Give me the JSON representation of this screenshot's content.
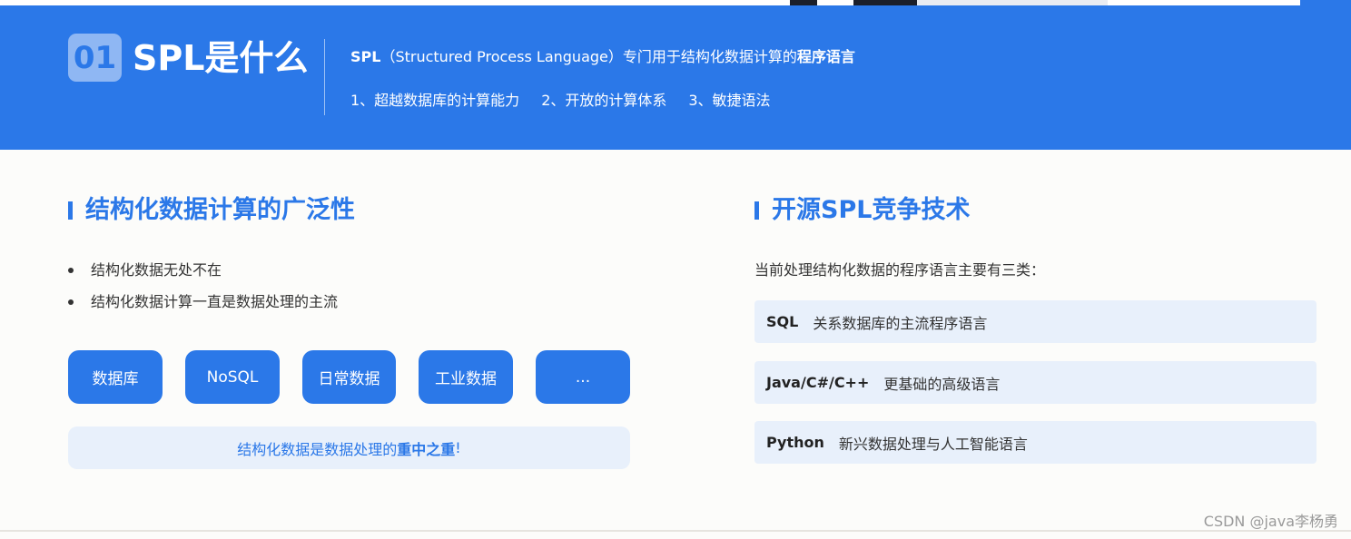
{
  "banner": {
    "number": "01",
    "title": "SPL是什么",
    "desc_bold_prefix": "SPL",
    "desc_middle": "（Structured Process Language）专门用于结构化数据计算的",
    "desc_bold_suffix": "程序语言",
    "features": [
      "1、超越数据库的计算能力",
      "2、开放的计算体系",
      "3、敏捷语法"
    ],
    "colors": {
      "background": "#2b78e8",
      "badge": "#8fb7f3"
    }
  },
  "left": {
    "title": "结构化数据计算的广泛性",
    "bullets": [
      "结构化数据无处不在",
      "结构化数据计算一直是数据处理的主流"
    ],
    "chips": [
      "数据库",
      "NoSQL",
      "日常数据",
      "工业数据",
      "..."
    ],
    "note_prefix": "结构化数据是数据处理的",
    "note_bold": "重中之重",
    "note_suffix": "!"
  },
  "right": {
    "title": "开源SPL竞争技术",
    "intro": "当前处理结构化数据的程序语言主要有三类：",
    "languages": [
      {
        "name": "SQL",
        "desc": "关系数据库的主流程序语言"
      },
      {
        "name": "Java/C#/C++",
        "desc": "更基础的高级语言"
      },
      {
        "name": "Python",
        "desc": "新兴数据处理与人工智能语言"
      }
    ]
  },
  "watermark": "CSDN @java李杨勇",
  "colors": {
    "accent": "#2b78e8",
    "light_panel": "#e8f0fb"
  }
}
